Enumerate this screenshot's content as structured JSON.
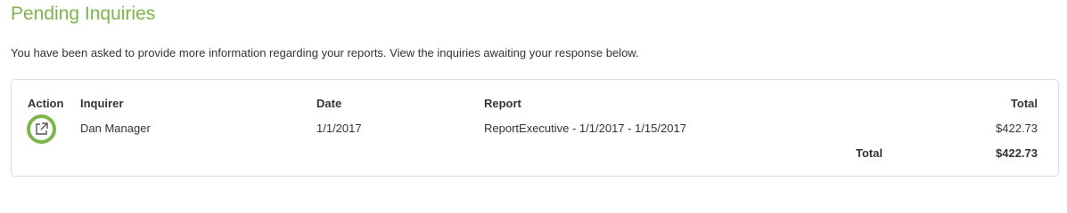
{
  "page": {
    "title": "Pending Inquiries",
    "intro": "You have been asked to provide more information regarding your reports. View the inquiries awaiting your response below."
  },
  "table": {
    "columns": {
      "action": "Action",
      "inquirer": "Inquirer",
      "date": "Date",
      "report": "Report",
      "total": "Total"
    },
    "rows": [
      {
        "action_icon": "external-link-icon",
        "inquirer": "Dan Manager",
        "date": "1/1/2017",
        "report": "ReportExecutive - 1/1/2017 - 1/15/2017",
        "total": "$422.73"
      }
    ],
    "footer": {
      "label": "Total",
      "value": "$422.73"
    }
  },
  "colors": {
    "accent": "#7ab648",
    "text": "#333333",
    "border": "#dcdcdc"
  }
}
